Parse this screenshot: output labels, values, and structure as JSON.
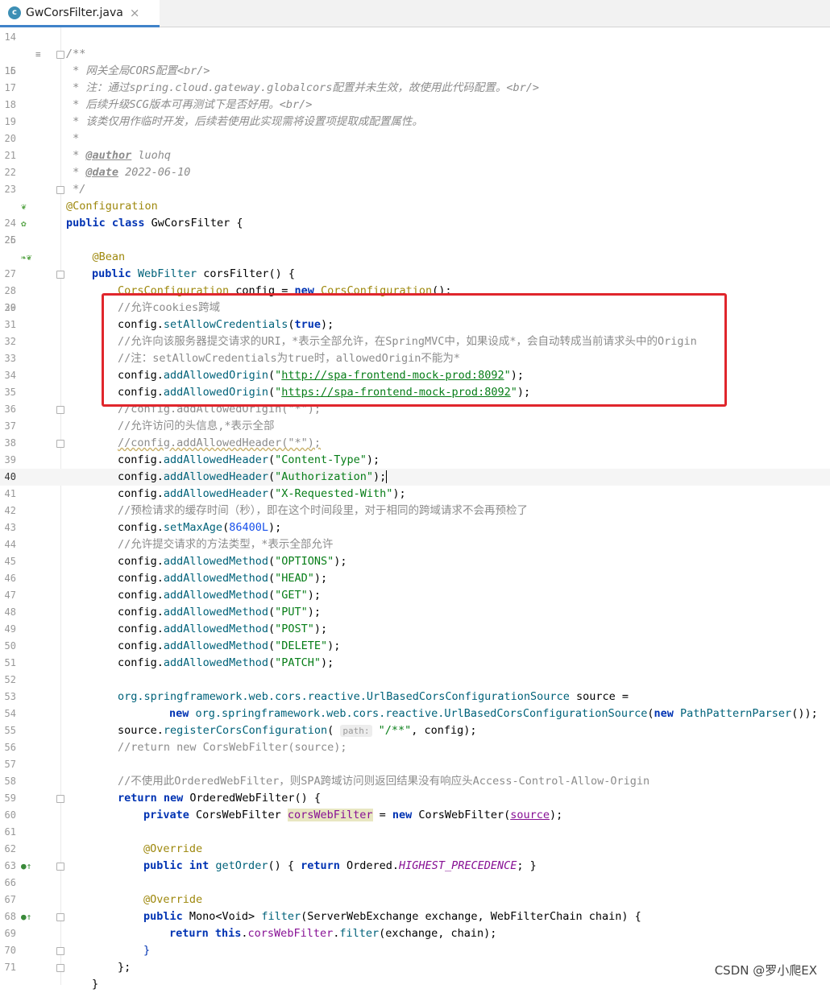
{
  "tab": {
    "icon_letter": "c",
    "title": "GwCorsFilter.java",
    "close": "×"
  },
  "watermark": "CSDN @罗小爬EX",
  "lines": [
    {
      "n": "14",
      "t": ""
    },
    {
      "n": "15",
      "t": "/**"
    },
    {
      "n": "16",
      "t": " * 网关全局CORS配置<br/>"
    },
    {
      "n": "17",
      "t": " * 注：通过spring.cloud.gateway.globalcors配置并未生效，故使用此代码配置。<br/>"
    },
    {
      "n": "18",
      "t": " * 后续升级SCG版本可再测试下是否好用。<br/>"
    },
    {
      "n": "19",
      "t": " * 该类仅用作临时开发，后续若使用此实现需将设置项提取成配置属性。"
    },
    {
      "n": "20",
      "t": " *"
    },
    {
      "n": "21",
      "a": " * ",
      "b": "@author",
      "c": " luohq"
    },
    {
      "n": "22",
      "a": " * ",
      "b": "@date",
      "c": " 2022-06-10"
    },
    {
      "n": "23",
      "t": " */"
    },
    {
      "n": "24",
      "t": "@Configuration"
    },
    {
      "n": "25",
      "kw": "public class",
      "t": " GwCorsFilter {"
    },
    {
      "n": "26",
      "t": ""
    },
    {
      "n": "27",
      "t": "    @Bean"
    },
    {
      "n": "28",
      "kw": "public",
      "ty": "WebFilter",
      "m": "corsFilter",
      "t": "() {"
    },
    {
      "n": "29",
      "ty": "CorsConfiguration",
      "v": " config = ",
      "kw": "new",
      "t": "CorsConfiguration",
      "e": "();"
    },
    {
      "n": "30",
      "t": "//允许cookies跨域"
    },
    {
      "n": "31",
      "m": "setAllowCredentials",
      "kw": "true"
    },
    {
      "n": "32",
      "t": "//允许向该服务器提交请求的URI，*表示全部允许，在SpringMVC中，如果设成*，会自动转成当前请求头中的Origin"
    },
    {
      "n": "33",
      "t": "//注：setAllowCredentials为true时，allowedOrigin不能为*"
    },
    {
      "n": "34",
      "m": "addAllowedOrigin",
      "s": "http://spa-frontend-mock-prod:8092"
    },
    {
      "n": "35",
      "m": "addAllowedOrigin",
      "s": "https://spa-frontend-mock-prod:8092"
    },
    {
      "n": "36",
      "t": "//config.addAllowedOrigin(\"*\");"
    },
    {
      "n": "37",
      "t": "//允许访问的头信息,*表示全部"
    },
    {
      "n": "38",
      "t": "//config.addAllowedHeader(\"*\");"
    },
    {
      "n": "39",
      "m": "addAllowedHeader",
      "s": "\"Content-Type\""
    },
    {
      "n": "40",
      "m": "addAllowedHeader",
      "s": "\"Authorization\""
    },
    {
      "n": "41",
      "m": "addAllowedHeader",
      "s": "\"X-Requested-With\""
    },
    {
      "n": "42",
      "t": "//预检请求的缓存时间（秒），即在这个时间段里，对于相同的跨域请求不会再预检了"
    },
    {
      "n": "43",
      "m": "setMaxAge",
      "num": "86400L"
    },
    {
      "n": "44",
      "t": "//允许提交请求的方法类型，*表示全部允许"
    },
    {
      "n": "45",
      "m": "addAllowedMethod",
      "s": "\"OPTIONS\""
    },
    {
      "n": "46",
      "m": "addAllowedMethod",
      "s": "\"HEAD\""
    },
    {
      "n": "47",
      "m": "addAllowedMethod",
      "s": "\"GET\""
    },
    {
      "n": "48",
      "m": "addAllowedMethod",
      "s": "\"PUT\""
    },
    {
      "n": "49",
      "m": "addAllowedMethod",
      "s": "\"POST\""
    },
    {
      "n": "50",
      "m": "addAllowedMethod",
      "s": "\"DELETE\""
    },
    {
      "n": "51",
      "m": "addAllowedMethod",
      "s": "\"PATCH\""
    },
    {
      "n": "52",
      "t": ""
    },
    {
      "n": "53",
      "pk": "org.springframework.web.cors.reactive.",
      "ty": "UrlBasedCorsConfigurationSource",
      "t": " source ="
    },
    {
      "n": "54",
      "kw": "new",
      "pk": " org.springframework.web.cors.reactive.",
      "ty": "UrlBasedCorsConfigurationSource",
      "kw2": "new",
      "ty2": " PathPatternParser",
      "t": "());"
    },
    {
      "n": "55",
      "v": "source.",
      "m": "registerCorsConfiguration",
      "h": "path:",
      "s": "\"/**\"",
      "t": ", config);"
    },
    {
      "n": "56",
      "t": "//return new CorsWebFilter(source);"
    },
    {
      "n": "57",
      "t": ""
    },
    {
      "n": "58",
      "t": "//不使用此OrderedWebFilter，则SPA跨域访问则返回结果没有响应头Access-Control-Allow-Origin"
    },
    {
      "n": "59",
      "kw": "return new",
      "ty": " OrderedWebFilter",
      "t": "() {"
    },
    {
      "n": "60",
      "kw": "private",
      "ty": " CorsWebFilter ",
      "f": "corsWebFilter",
      "kw2": " new",
      "ty2": " CorsWebFilter",
      "v": "source"
    },
    {
      "n": "61",
      "t": ""
    },
    {
      "n": "62",
      "t": "@Override"
    },
    {
      "n": "63",
      "kw": "public int",
      "m": "getOrder",
      "kw2": "return",
      "ty": "Ordered.",
      "c": "HIGHEST_PRECEDENCE"
    },
    {
      "n": "66",
      "t": ""
    },
    {
      "n": "67",
      "t": "@Override"
    },
    {
      "n": "68",
      "kw": "public",
      "ty": " Mono<Void>",
      "m": " filter",
      "t": "(ServerWebExchange exchange, WebFilterChain chain) {"
    },
    {
      "n": "69",
      "kw": "return this",
      "f": "corsWebFilter",
      "m": "filter",
      "t": "(exchange, chain);"
    },
    {
      "n": "70",
      "t": "}"
    },
    {
      "n": "71",
      "t": "};"
    },
    {
      "n": "",
      "t": "}"
    }
  ]
}
